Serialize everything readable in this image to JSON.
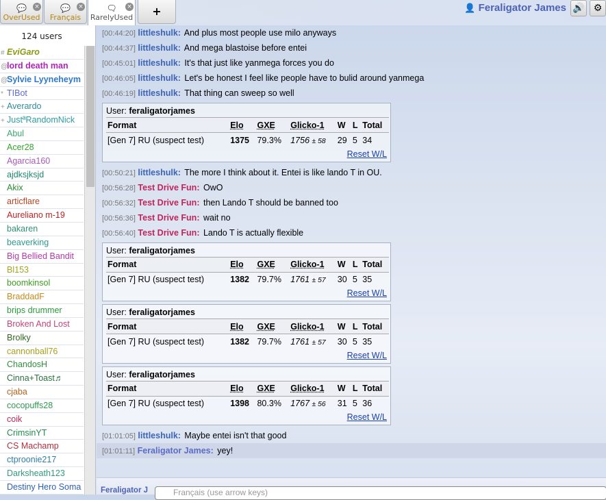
{
  "tabs": [
    {
      "label": "OverUsed",
      "icon": "chat-icon",
      "close": "×",
      "color": "#b8860b"
    },
    {
      "label": "Français",
      "icon": "chat-icon",
      "close": "×",
      "color": "#b8860b"
    },
    {
      "label": "RarelyUsed",
      "icon": "chat-bubble-icon",
      "close": "×",
      "color": "#555555"
    }
  ],
  "new_tab_label": "+",
  "user": {
    "name": "Feraligator James",
    "icon": "user-icon"
  },
  "buttons": {
    "sound": "🔊",
    "settings": "⚙"
  },
  "userlist": {
    "count": "124 users",
    "users": [
      {
        "rank": "#",
        "name": "EviGaro",
        "color": "#8a9a13",
        "bold": true,
        "italic": true
      },
      {
        "rank": "@",
        "name": "lord death man",
        "color": "#b023b8",
        "bold": true
      },
      {
        "rank": "@",
        "name": "Sylvie Lyyneheym",
        "color": "#2e79c9",
        "bold": true
      },
      {
        "rank": "*",
        "name": "TIBot",
        "color": "#5f6ad1"
      },
      {
        "rank": "+",
        "name": "Averardo",
        "color": "#2f8d99"
      },
      {
        "rank": "+",
        "name": "JustªRandomNick",
        "color": "#2e9da0"
      },
      {
        "rank": "",
        "name": "Abul",
        "color": "#3aaa6d"
      },
      {
        "rank": "",
        "name": "Acer28",
        "color": "#33a52d"
      },
      {
        "rank": "",
        "name": "Agarcia160",
        "color": "#a859b8"
      },
      {
        "rank": "",
        "name": "ajdksjksjd",
        "color": "#1f8a6d"
      },
      {
        "rank": "",
        "name": "Akix",
        "color": "#2d8d33"
      },
      {
        "rank": "",
        "name": "articflare",
        "color": "#b8421f"
      },
      {
        "rank": "",
        "name": "Aureliano m-19",
        "color": "#c02222"
      },
      {
        "rank": "",
        "name": "bakaren",
        "color": "#2f9272"
      },
      {
        "rank": "",
        "name": "beaverking",
        "color": "#2c9a8c"
      },
      {
        "rank": "",
        "name": "Big Bellied Bandit",
        "color": "#b23aa8"
      },
      {
        "rank": "",
        "name": "Bl153",
        "color": "#a3a322"
      },
      {
        "rank": "",
        "name": "boomkinsol",
        "color": "#3c9d1f"
      },
      {
        "rank": "",
        "name": "BraddadF",
        "color": "#c78a1b"
      },
      {
        "rank": "",
        "name": "brips drummer",
        "color": "#2b9a3b"
      },
      {
        "rank": "",
        "name": "Broken And Lost",
        "color": "#c2437a"
      },
      {
        "rank": "",
        "name": "Brolky",
        "color": "#2e6a1a"
      },
      {
        "rank": "",
        "name": "cannonball76",
        "color": "#a7a01c"
      },
      {
        "rank": "",
        "name": "ChandosH",
        "color": "#2f8f3d"
      },
      {
        "rank": "",
        "name": "Cinna+Toast♬",
        "color": "#2a6f3a"
      },
      {
        "rank": "",
        "name": "cjaba",
        "color": "#b8611a"
      },
      {
        "rank": "",
        "name": "cocopuffs28",
        "color": "#2f9a51"
      },
      {
        "rank": "",
        "name": "coik",
        "color": "#c2245a"
      },
      {
        "rank": "",
        "name": "CrimsinYT",
        "color": "#1f8a4a"
      },
      {
        "rank": "",
        "name": "CS Machamp",
        "color": "#b22f3c"
      },
      {
        "rank": "",
        "name": "ctproonie217",
        "color": "#2f7ea8"
      },
      {
        "rank": "",
        "name": "Darksheath123",
        "color": "#2f9a7a"
      },
      {
        "rank": "",
        "name": "Destiny Hero Soma",
        "color": "#2d5fb0"
      }
    ]
  },
  "chat": [
    {
      "type": "msg",
      "ts": "[00:44:20]",
      "nick": "littleshulk:",
      "nick_color": "#3e64b5",
      "text": "And plus most people use milo anyways"
    },
    {
      "type": "msg",
      "ts": "[00:44:37]",
      "nick": "littleshulk:",
      "nick_color": "#3e64b5",
      "text": "And mega blastoise before entei"
    },
    {
      "type": "msg",
      "ts": "[00:45:01]",
      "nick": "littleshulk:",
      "nick_color": "#3e64b5",
      "text": "It's that just like yanmega forces you do"
    },
    {
      "type": "msg",
      "ts": "[00:46:05]",
      "nick": "littleshulk:",
      "nick_color": "#3e64b5",
      "text": "Let's be honest I feel like people have to bulid around yanmega"
    },
    {
      "type": "msg",
      "ts": "[00:46:19]",
      "nick": "littleshulk:",
      "nick_color": "#3e64b5",
      "text": "That thing can sweep so well"
    },
    {
      "type": "rank",
      "user_label": "User:",
      "user": "feraligatorjames",
      "headers": [
        "Format",
        "Elo",
        "GXE",
        "Glicko-1",
        "W",
        "L",
        "Total"
      ],
      "format": "[Gen 7] RU (suspect test)",
      "elo": "1375",
      "gxe": "79.3%",
      "glicko": "1756",
      "glicko_dev": "± 58",
      "w": "29",
      "l": "5",
      "total": "34",
      "reset": "Reset W/L"
    },
    {
      "type": "msg",
      "ts": "[00:50:21]",
      "nick": "littleshulk:",
      "nick_color": "#3e64b5",
      "text": "The more I think about it. Entei is like lando T in OU."
    },
    {
      "type": "msg",
      "ts": "[00:56:28]",
      "nick": "Test Drive Fun:",
      "nick_color": "#c2245a",
      "text": "OwO"
    },
    {
      "type": "msg",
      "ts": "[00:56:32]",
      "nick": "Test Drive Fun:",
      "nick_color": "#c2245a",
      "text": "then Lando T should be banned too"
    },
    {
      "type": "msg",
      "ts": "[00:56:36]",
      "nick": "Test Drive Fun:",
      "nick_color": "#c2245a",
      "text": "wait no"
    },
    {
      "type": "msg",
      "ts": "[00:56:40]",
      "nick": "Test Drive Fun:",
      "nick_color": "#c2245a",
      "text": "Lando T is actually flexible"
    },
    {
      "type": "rank",
      "user_label": "User:",
      "user": "feraligatorjames",
      "headers": [
        "Format",
        "Elo",
        "GXE",
        "Glicko-1",
        "W",
        "L",
        "Total"
      ],
      "format": "[Gen 7] RU (suspect test)",
      "elo": "1382",
      "gxe": "79.7%",
      "glicko": "1761",
      "glicko_dev": "± 57",
      "w": "30",
      "l": "5",
      "total": "35",
      "reset": "Reset W/L"
    },
    {
      "type": "rank",
      "user_label": "User:",
      "user": "feraligatorjames",
      "headers": [
        "Format",
        "Elo",
        "GXE",
        "Glicko-1",
        "W",
        "L",
        "Total"
      ],
      "format": "[Gen 7] RU (suspect test)",
      "elo": "1382",
      "gxe": "79.7%",
      "glicko": "1761",
      "glicko_dev": "± 57",
      "w": "30",
      "l": "5",
      "total": "35",
      "reset": "Reset W/L"
    },
    {
      "type": "rank",
      "user_label": "User:",
      "user": "feraligatorjames",
      "headers": [
        "Format",
        "Elo",
        "GXE",
        "Glicko-1",
        "W",
        "L",
        "Total"
      ],
      "format": "[Gen 7] RU (suspect test)",
      "elo": "1398",
      "gxe": "80.3%",
      "glicko": "1767",
      "glicko_dev": "± 56",
      "w": "31",
      "l": "5",
      "total": "36",
      "reset": "Reset W/L"
    },
    {
      "type": "msg",
      "ts": "[01:01:05]",
      "nick": "littleshulk:",
      "nick_color": "#3e64b5",
      "text": "Maybe entei isn't that good"
    },
    {
      "type": "msg",
      "ts": "[01:01:11]",
      "nick": "Feraligator James:",
      "nick_color": "#5b6cc8",
      "text": "yey!",
      "highlight": true
    }
  ],
  "composer": {
    "name": "Feraligator J",
    "placeholder": "Français (use arrow keys)"
  }
}
